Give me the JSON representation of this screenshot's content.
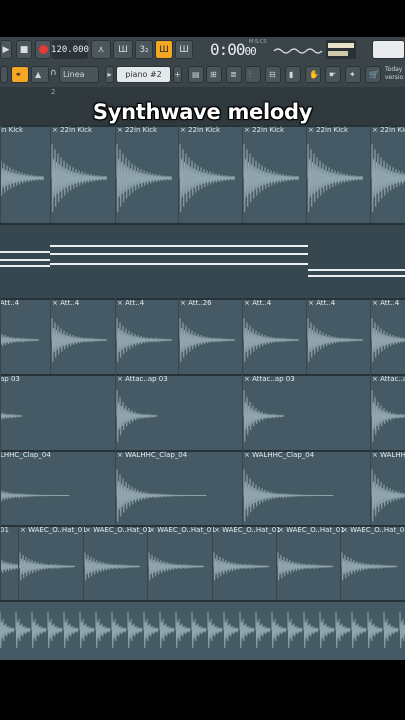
{
  "toolbar": {
    "tempo": "120.000",
    "time": "0:00",
    "time_sub": "00",
    "time_unit": "M:S:CS",
    "mode_label": "Linea",
    "pattern_name": "piano #2",
    "right_text": "Today",
    "right_text2": "versio"
  },
  "overlay_title": "Synthwave melody",
  "ruler": {
    "mark": "2"
  },
  "tracks": [
    {
      "clip_label": "22in Kick",
      "first_label": "in Kick"
    },
    {
      "clip_label": ""
    },
    {
      "clip_label": "Att..4",
      "alt_label": "Att..26"
    },
    {
      "clip_label": "Attac..ap 03",
      "first_label": "ap 03"
    },
    {
      "clip_label": "WALHHC_Clap_04",
      "first_label": "LHHC_Clap_04"
    },
    {
      "clip_label": "WAEC_O..Hat_01",
      "first_label": "01"
    },
    {
      "clip_label": ""
    }
  ],
  "colors": {
    "track_bg": "#455a64",
    "waveform": "#90a4ae",
    "accent": "#f5a623"
  }
}
